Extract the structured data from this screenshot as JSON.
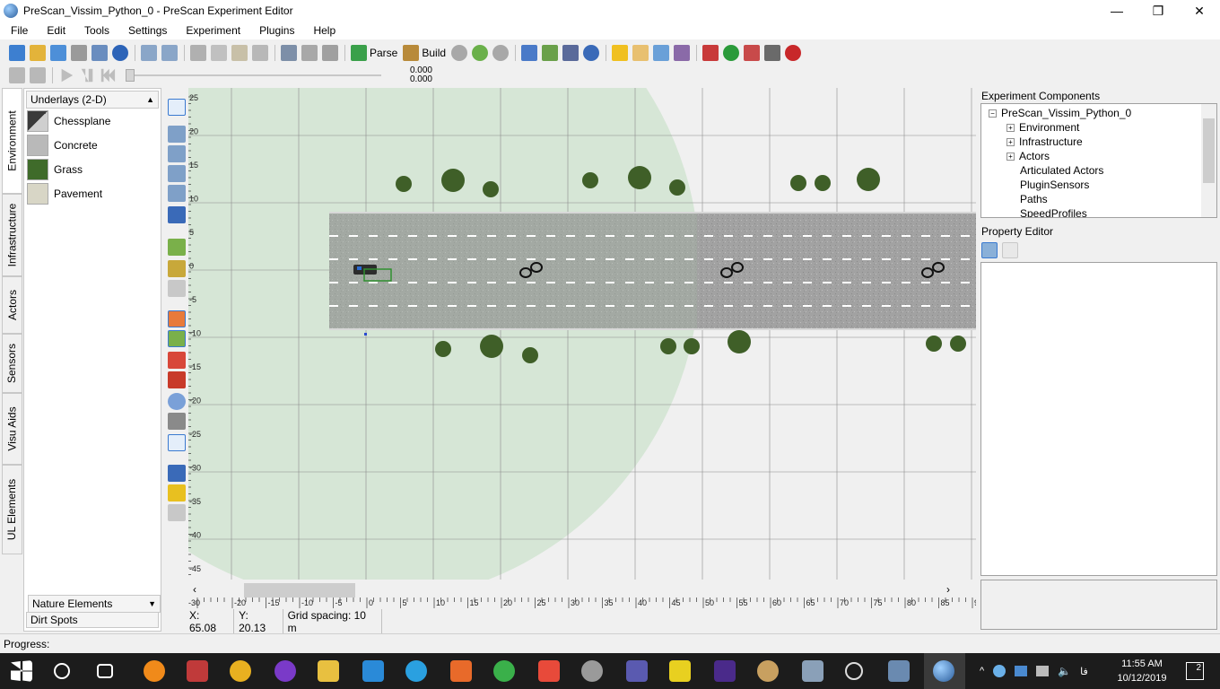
{
  "window": {
    "title": "PreScan_Vissim_Python_0 - PreScan Experiment Editor",
    "minimize": "—",
    "maximize": "❐",
    "close": "✕"
  },
  "menu": [
    "File",
    "Edit",
    "Tools",
    "Settings",
    "Experiment",
    "Plugins",
    "Help"
  ],
  "toolbar": {
    "parse_label": "Parse",
    "build_label": "Build"
  },
  "simulation": {
    "time_value": "0.000",
    "end_value": "0.000"
  },
  "side_tabs": [
    "Environment",
    "Infrastructure",
    "Actors",
    "Sensors",
    "Visu Aids",
    "UL Elements"
  ],
  "left_panel": {
    "header": "Underlays (2-D)",
    "items": [
      "Chessplane",
      "Concrete",
      "Grass",
      "Pavement"
    ],
    "nature_header": "Nature Elements",
    "dirt_header": "Dirt Spots"
  },
  "canvas": {
    "y_ticks": [
      "25",
      "20",
      "15",
      "10",
      "5",
      "0",
      "-5",
      "-10",
      "-15",
      "-20",
      "-25",
      "-30",
      "-35",
      "-40",
      "-45"
    ],
    "x_ticks": [
      "-30",
      "-20",
      "-15",
      "-10",
      "-5",
      "0",
      "5",
      "10",
      "15",
      "20",
      "25",
      "30",
      "35",
      "40",
      "45",
      "50",
      "55",
      "60",
      "65",
      "70",
      "75",
      "80",
      "85",
      "9"
    ]
  },
  "status": {
    "x": "X: 65.08",
    "y": "Y: 20.13",
    "grid": "Grid spacing: 10 m"
  },
  "progress_label": "Progress:",
  "right_panel": {
    "components_label": "Experiment Components",
    "tree_root": "PreScan_Vissim_Python_0",
    "tree_items": [
      "Environment",
      "Infrastructure",
      "Actors",
      "Articulated Actors",
      "PluginSensors",
      "Paths",
      "SpeedProfiles"
    ],
    "property_editor_label": "Property Editor"
  },
  "taskbar": {
    "time": "11:55 AM",
    "date": "10/12/2019",
    "lang": "فا",
    "notifications": "2"
  },
  "colors": {
    "sensor_range": "#d6e6d6",
    "road": "#9a9a9a",
    "grid": "#8a8a8a"
  }
}
